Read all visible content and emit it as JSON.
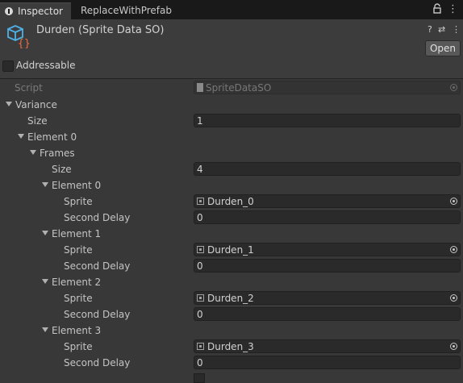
{
  "tabs": {
    "inspector": "Inspector",
    "replace": "ReplaceWithPrefab",
    "lock_icon": "lock-icon",
    "menu_icon": "kebab-menu-icon"
  },
  "header": {
    "title": "Durden (Sprite Data SO)",
    "help": "?",
    "settings": "⇄",
    "more": "⋮",
    "open_label": "Open",
    "addressable_label": "Addressable"
  },
  "fields": {
    "script_label": "Script",
    "script_value": "SpriteDataSO",
    "variance": "Variance",
    "size_label": "Size",
    "variance_size": "1",
    "element0": "Element 0",
    "frames": "Frames",
    "frames_size": "4",
    "frame_elements": [
      {
        "label": "Element 0",
        "sprite": "Durden_0",
        "delay": "0"
      },
      {
        "label": "Element 1",
        "sprite": "Durden_1",
        "delay": "0"
      },
      {
        "label": "Element 2",
        "sprite": "Durden_2",
        "delay": "0"
      },
      {
        "label": "Element 3",
        "sprite": "Durden_3",
        "delay": "0"
      }
    ],
    "sprite_label": "Sprite",
    "delay_label": "Second Delay"
  }
}
